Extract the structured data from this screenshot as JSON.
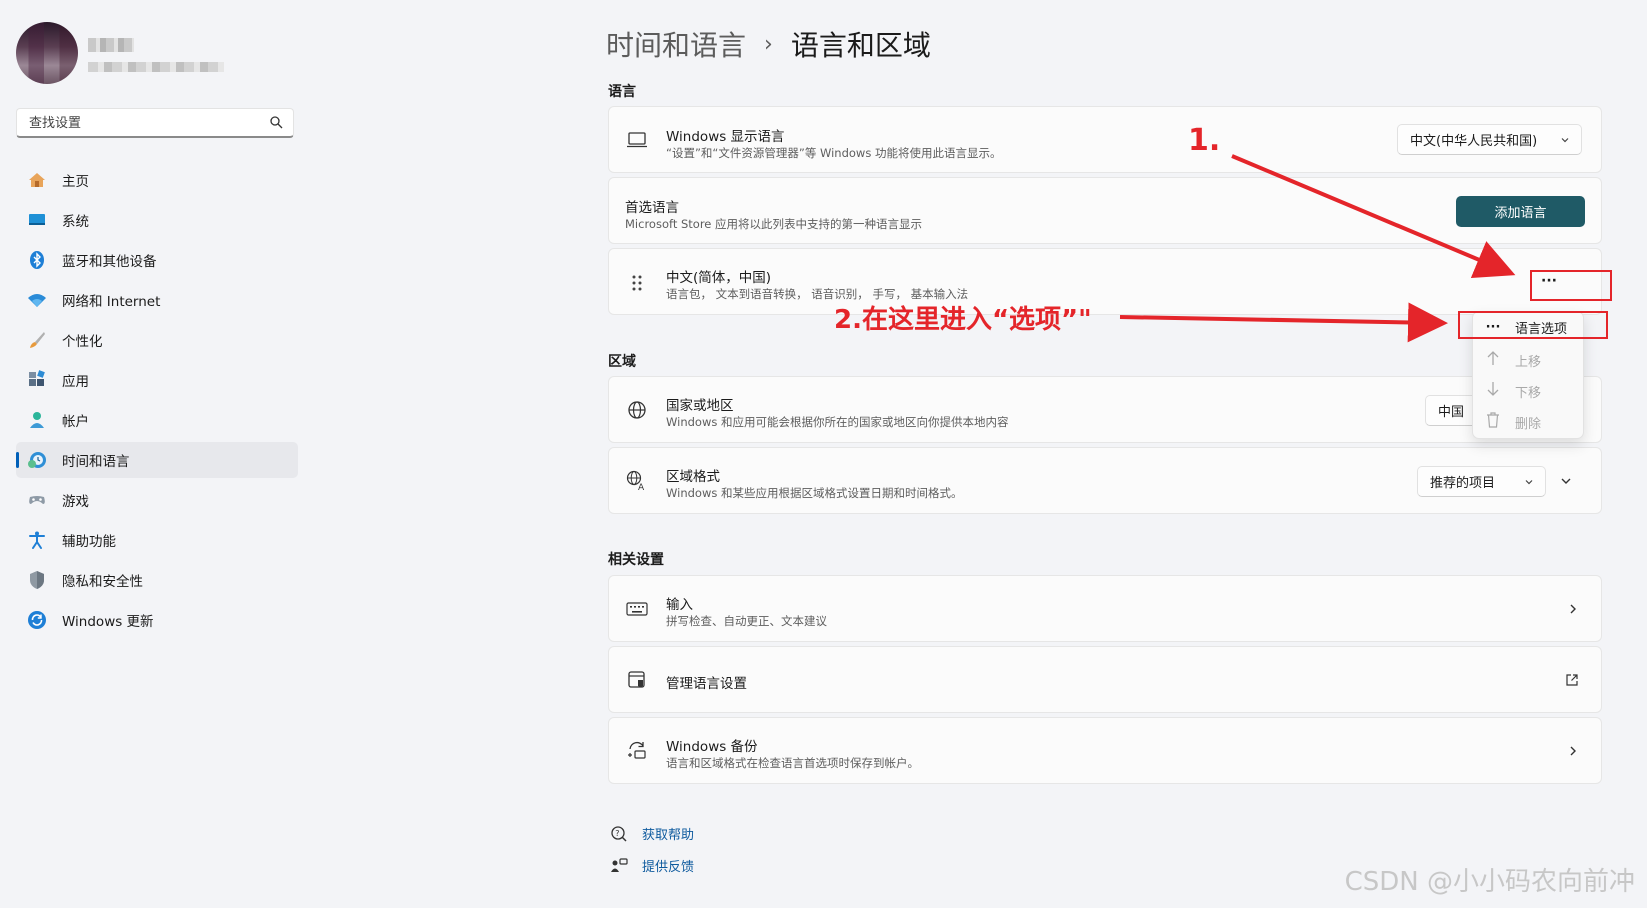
{
  "breadcrumb": {
    "parent": "时间和语言",
    "separator": "›",
    "current": "语言和区域"
  },
  "search": {
    "placeholder": "查找设置"
  },
  "nav": [
    {
      "label": "主页",
      "icon": "home-icon"
    },
    {
      "label": "系统",
      "icon": "monitor-icon"
    },
    {
      "label": "蓝牙和其他设备",
      "icon": "bluetooth-icon"
    },
    {
      "label": "网络和 Internet",
      "icon": "wifi-icon"
    },
    {
      "label": "个性化",
      "icon": "brush-icon"
    },
    {
      "label": "应用",
      "icon": "apps-icon"
    },
    {
      "label": "帐户",
      "icon": "person-icon"
    },
    {
      "label": "时间和语言",
      "icon": "clock-globe-icon",
      "active": true
    },
    {
      "label": "游戏",
      "icon": "gamepad-icon"
    },
    {
      "label": "辅助功能",
      "icon": "accessibility-icon"
    },
    {
      "label": "隐私和安全性",
      "icon": "shield-icon"
    },
    {
      "label": "Windows 更新",
      "icon": "update-icon"
    }
  ],
  "sections": {
    "language": "语言",
    "region": "区域",
    "related": "相关设置"
  },
  "display_language": {
    "title": "Windows 显示语言",
    "desc": "“设置”和“文件资源管理器”等 Windows 功能将使用此语言显示。",
    "value": "中文(中华人民共和国)"
  },
  "preferred": {
    "title": "首选语言",
    "desc": "Microsoft Store 应用将以此列表中支持的第一种语言显示",
    "button": "添加语言"
  },
  "chinese": {
    "title": "中文(简体，中国)",
    "desc": "语言包， 文本到语音转换， 语音识别， 手写， 基本输入法",
    "more": "···"
  },
  "menu": {
    "options": "语言选项",
    "up": "上移",
    "down": "下移",
    "delete": "删除"
  },
  "country": {
    "title": "国家或地区",
    "desc": "Windows 和应用可能会根据你所在的国家或地区向你提供本地内容",
    "value": "中国"
  },
  "format": {
    "title": "区域格式",
    "desc": "Windows 和某些应用根据区域格式设置日期和时间格式。",
    "value": "推荐的项目"
  },
  "input": {
    "title": "输入",
    "desc": "拼写检查、自动更正、文本建议"
  },
  "admin": {
    "title": "管理语言设置"
  },
  "backup": {
    "title": "Windows 备份",
    "desc": "语言和区域格式在检查语言首选项时保存到帐户。"
  },
  "footer": {
    "help": "获取帮助",
    "feedback": "提供反馈"
  },
  "annotations": {
    "step1": "1.",
    "step2": "2.在这里进入“选项”\""
  },
  "watermark": "CSDN @小小码农向前冲",
  "colors": {
    "accent": "#005fb8",
    "primary_button": "#1f5a66",
    "annotation": "#e4252a"
  }
}
